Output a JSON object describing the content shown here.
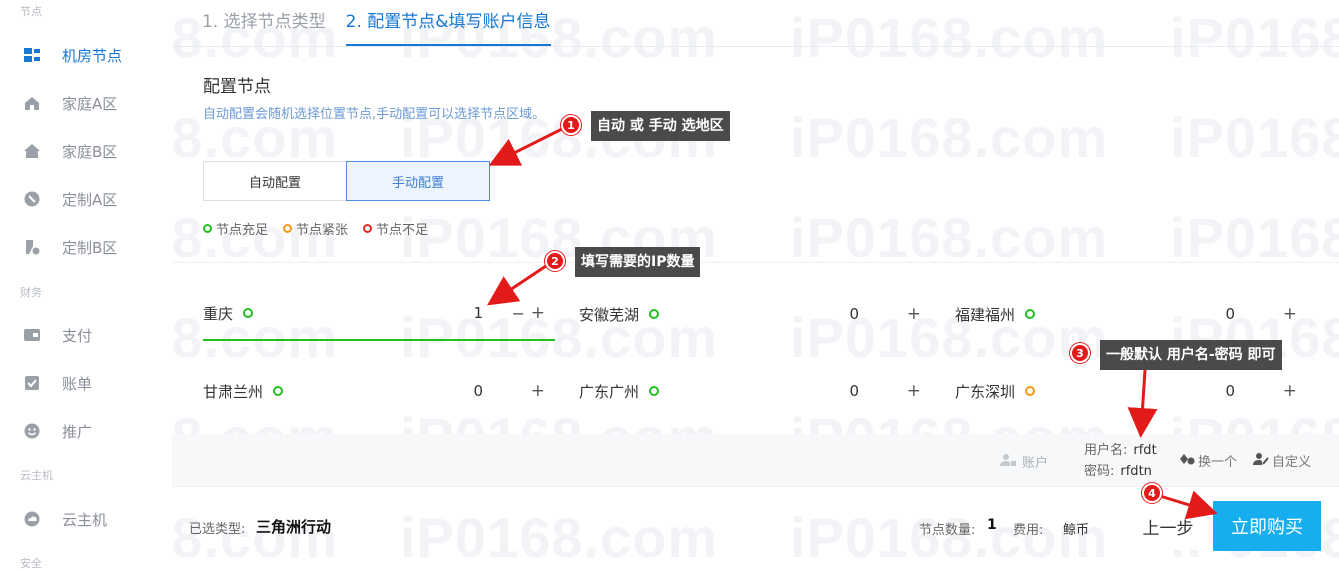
{
  "watermark": "iP0168.com",
  "sidebar": {
    "sections": [
      "节点",
      "财务",
      "云主机",
      "安全"
    ],
    "items": [
      {
        "label": "机房节点",
        "icon": "server-room-icon",
        "active": true
      },
      {
        "label": "家庭A区",
        "icon": "house-a-icon"
      },
      {
        "label": "家庭B区",
        "icon": "house-b-icon"
      },
      {
        "label": "定制A区",
        "icon": "custom-a-icon"
      },
      {
        "label": "定制B区",
        "icon": "custom-b-icon"
      },
      {
        "label": "支付",
        "icon": "wallet-icon"
      },
      {
        "label": "账单",
        "icon": "bill-icon"
      },
      {
        "label": "推广",
        "icon": "promote-icon"
      },
      {
        "label": "云主机",
        "icon": "cloud-icon"
      }
    ]
  },
  "steps": [
    "1. 选择节点类型",
    "2. 配置节点&填写账户信息"
  ],
  "config": {
    "title": "配置节点",
    "desc": "自动配置会随机选择位置节点,手动配置可以选择节点区域。",
    "auto_label": "自动配置",
    "manual_label": "手动配置"
  },
  "legend": [
    "节点充足",
    "节点紧张",
    "节点不足"
  ],
  "nodes": [
    {
      "name": "重庆",
      "status": "green",
      "qty": "1",
      "selected": true
    },
    {
      "name": "安徽芜湖",
      "status": "green",
      "qty": "0"
    },
    {
      "name": "福建福州",
      "status": "green",
      "qty": "0"
    },
    {
      "name": "甘肃兰州",
      "status": "green",
      "qty": "0"
    },
    {
      "name": "广东广州",
      "status": "green",
      "qty": "0"
    },
    {
      "name": "广东深圳",
      "status": "orange",
      "qty": "0"
    }
  ],
  "account": {
    "label": "账户",
    "user_label": "用户名:",
    "user_value": "rfdt",
    "pass_label": "密码:",
    "pass_value": "rfdtn",
    "change_label": "换一个",
    "custom_label": "自定义"
  },
  "footer": {
    "selected_type_label": "已选类型:",
    "selected_type_value": "三角洲行动",
    "count_label": "节点数量:",
    "count_value": "1",
    "fee_label": "费用:",
    "fee_value": "鲸币",
    "prev_label": "上一步",
    "buy_label": "立即购买"
  },
  "annotations": [
    {
      "num": "1",
      "text": "自动 或 手动 选地区"
    },
    {
      "num": "2",
      "text": "填写需要的IP数量"
    },
    {
      "num": "3",
      "text": "一般默认 用户名-密码 即可"
    },
    {
      "num": "4",
      "text": ""
    }
  ],
  "colors": {
    "accent": "#1677d4",
    "buy": "#17aef0",
    "green": "#22c022",
    "orange": "#f19a19",
    "red": "#e02828",
    "annotation": "#e31a1a"
  }
}
